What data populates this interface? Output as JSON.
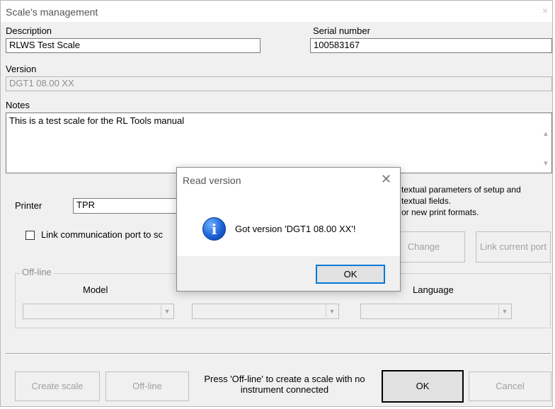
{
  "window": {
    "title": "Scale's management",
    "close_glyph": "×"
  },
  "fields": {
    "description_label": "Description",
    "description_value": "RLWS Test Scale",
    "serial_label": "Serial number",
    "serial_value": "100583167",
    "version_label": "Version",
    "version_value": "DGT1 08.00 XX",
    "notes_label": "Notes",
    "notes_value": "This is a test scale for the RL Tools manual"
  },
  "info_text": {
    "line1": "textual parameters of setup and",
    "line2": "textual fields.",
    "line3": "or new print formats."
  },
  "printer": {
    "label": "Printer",
    "value": "TPR"
  },
  "link_port": {
    "checkbox_label": "Link communication port to sc",
    "change_button": "Change",
    "link_current_port_button": "Link current port"
  },
  "offline_group": {
    "title": "Off-line",
    "model_label": "Model",
    "language_label": "Language"
  },
  "footer": {
    "create_scale_button": "Create scale",
    "offline_button": "Off-line",
    "hint": "Press 'Off-line' to create a scale with no instrument connected",
    "ok_button": "OK",
    "cancel_button": "Cancel"
  },
  "dialog": {
    "title": "Read version",
    "close_glyph": "✕",
    "icon": "info-icon",
    "message": "Got version 'DGT1 08.00 XX'!",
    "ok_button": "OK"
  },
  "colors": {
    "window_bg": "#f0f0f0",
    "info_icon_blue": "#1c63d8",
    "disabled_text": "#8d8d8d"
  }
}
